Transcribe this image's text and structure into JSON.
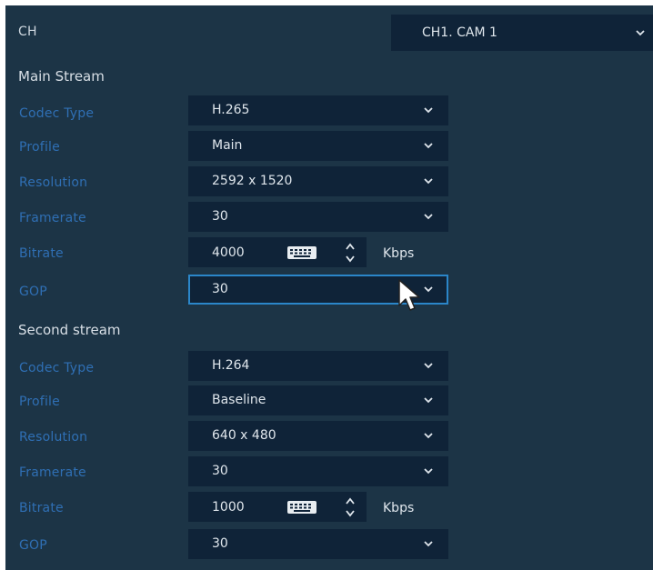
{
  "channel": {
    "label": "CH",
    "selected": "CH1. CAM 1"
  },
  "main_stream": {
    "title": "Main Stream",
    "codec_type": {
      "label": "Codec Type",
      "value": "H.265"
    },
    "profile": {
      "label": "Profile",
      "value": "Main"
    },
    "resolution": {
      "label": "Resolution",
      "value": "2592 x 1520"
    },
    "framerate": {
      "label": "Framerate",
      "value": "30"
    },
    "bitrate": {
      "label": "Bitrate",
      "value": "4000",
      "unit": "Kbps"
    },
    "gop": {
      "label": "GOP",
      "value": "30"
    }
  },
  "second_stream": {
    "title": "Second stream",
    "codec_type": {
      "label": "Codec Type",
      "value": "H.264"
    },
    "profile": {
      "label": "Profile",
      "value": "Baseline"
    },
    "resolution": {
      "label": "Resolution",
      "value": "640 x 480"
    },
    "framerate": {
      "label": "Framerate",
      "value": "30"
    },
    "bitrate": {
      "label": "Bitrate",
      "value": "1000",
      "unit": "Kbps"
    },
    "gop": {
      "label": "GOP",
      "value": "30"
    }
  },
  "icons": {
    "dropdown": "chevron-down-icon",
    "keyboard": "keyboard-icon",
    "spinner": "up-down-arrow-icon",
    "cursor": "mouse-pointer-icon"
  },
  "colors": {
    "panel_background": "#1c3446",
    "field_background": "#0f2338",
    "label_text": "#2f6fb4",
    "value_text": "#dfe6ec",
    "focus_border": "#2b86c9"
  }
}
